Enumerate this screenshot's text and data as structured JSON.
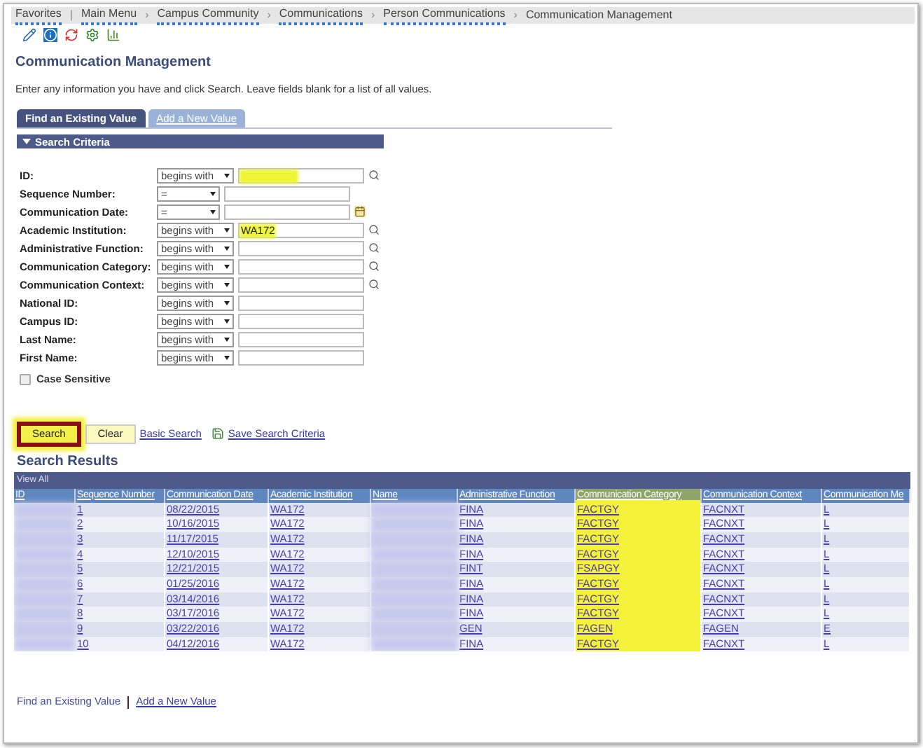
{
  "breadcrumb": [
    {
      "label": "Favorites",
      "menu": true
    },
    {
      "label": "Main Menu",
      "menu": true,
      "separator": "|"
    },
    {
      "label": "Campus Community",
      "menu": true,
      "separator": "›"
    },
    {
      "label": "Communications",
      "menu": true,
      "separator": "›"
    },
    {
      "label": "Person Communications",
      "menu": true,
      "separator": "›"
    },
    {
      "label": "Communication Management",
      "menu": false,
      "separator": "›"
    }
  ],
  "page": {
    "title": "Communication Management",
    "instructions": "Enter any information you have and click Search. Leave fields blank for a list of all values."
  },
  "tabs": [
    {
      "label": "Find an Existing Value",
      "selected": true
    },
    {
      "label": "Add a New Value",
      "selected": false
    }
  ],
  "search_criteria": {
    "title": "Search Criteria",
    "expanded": true,
    "fields": [
      {
        "kind": "search",
        "label": "ID:",
        "operator": "begins with",
        "highlighted": true
      },
      {
        "kind": "plain",
        "label": "Sequence Number:",
        "operator": "=",
        "highlighted": false
      },
      {
        "kind": "calendar",
        "label": "Communication Date:",
        "operator": "=",
        "highlighted": false
      },
      {
        "kind": "search",
        "label": "Academic Institution:",
        "operator": "begins with",
        "value": "WA172",
        "highlighted": true
      },
      {
        "kind": "search",
        "label": "Administrative Function:",
        "operator": "begins with",
        "highlighted": false
      },
      {
        "kind": "search",
        "label": "Communication Category:",
        "operator": "begins with",
        "highlighted": false
      },
      {
        "kind": "search",
        "label": "Communication Context:",
        "operator": "begins with",
        "highlighted": false
      },
      {
        "kind": "plain",
        "label": "National ID:",
        "operator": "begins with",
        "highlighted": false
      },
      {
        "kind": "plain",
        "label": "Campus ID:",
        "operator": "begins with",
        "highlighted": false
      },
      {
        "kind": "plain",
        "label": "Last Name:",
        "operator": "begins with",
        "highlighted": false
      },
      {
        "kind": "plain",
        "label": "First Name:",
        "operator": "begins with",
        "highlighted": false
      }
    ],
    "case_sensitive": {
      "label": "Case Sensitive",
      "checked": false
    }
  },
  "actions": [
    {
      "kind": "button",
      "label": "Search",
      "highlighted": true
    },
    {
      "kind": "button",
      "label": "Clear",
      "highlighted": false
    },
    {
      "kind": "link",
      "label": "Basic Search"
    },
    {
      "kind": "save",
      "label": "Save Search Criteria"
    }
  ],
  "results": {
    "title": "Search Results",
    "view_all": "View All",
    "columns": [
      {
        "label": "ID",
        "highlighted": false
      },
      {
        "label": "Sequence Number",
        "highlighted": false
      },
      {
        "label": "Communication Date",
        "highlighted": false
      },
      {
        "label": "Academic Institution",
        "highlighted": false
      },
      {
        "label": "Name",
        "highlighted": false
      },
      {
        "label": "Administrative Function",
        "highlighted": false
      },
      {
        "label": "Communication Category",
        "highlighted": true
      },
      {
        "label": "Communication Context",
        "highlighted": false
      },
      {
        "label": "Communication Me",
        "highlighted": false
      }
    ],
    "rows": [
      [
        null,
        "1",
        "08/22/2015",
        "WA172",
        null,
        "FINA",
        "FACTGY",
        "FACNXT",
        "L"
      ],
      [
        null,
        "2",
        "10/16/2015",
        "WA172",
        null,
        "FINA",
        "FACTGY",
        "FACNXT",
        "L"
      ],
      [
        null,
        "3",
        "11/17/2015",
        "WA172",
        null,
        "FINA",
        "FACTGY",
        "FACNXT",
        "L"
      ],
      [
        null,
        "4",
        "12/10/2015",
        "WA172",
        null,
        "FINA",
        "FACTGY",
        "FACNXT",
        "L"
      ],
      [
        null,
        "5",
        "12/21/2015",
        "WA172",
        null,
        "FINT",
        "FSAPGY",
        "FACNXT",
        "L"
      ],
      [
        null,
        "6",
        "01/25/2016",
        "WA172",
        null,
        "FINA",
        "FACTGY",
        "FACNXT",
        "L"
      ],
      [
        null,
        "7",
        "03/14/2016",
        "WA172",
        null,
        "FINA",
        "FACTGY",
        "FACNXT",
        "L"
      ],
      [
        null,
        "8",
        "03/17/2016",
        "WA172",
        null,
        "FINA",
        "FACTGY",
        "FACNXT",
        "L"
      ],
      [
        null,
        "9",
        "03/22/2016",
        "WA172",
        null,
        "GEN",
        "FAGEN",
        "FAGEN",
        "E"
      ],
      [
        null,
        "10",
        "04/12/2016",
        "WA172",
        null,
        "FINA",
        "FACTGY",
        "FACNXT",
        "L"
      ]
    ]
  },
  "footer": [
    {
      "label": "Find an Existing Value",
      "link": false
    },
    {
      "label": "Add a New Value",
      "link": true
    }
  ]
}
